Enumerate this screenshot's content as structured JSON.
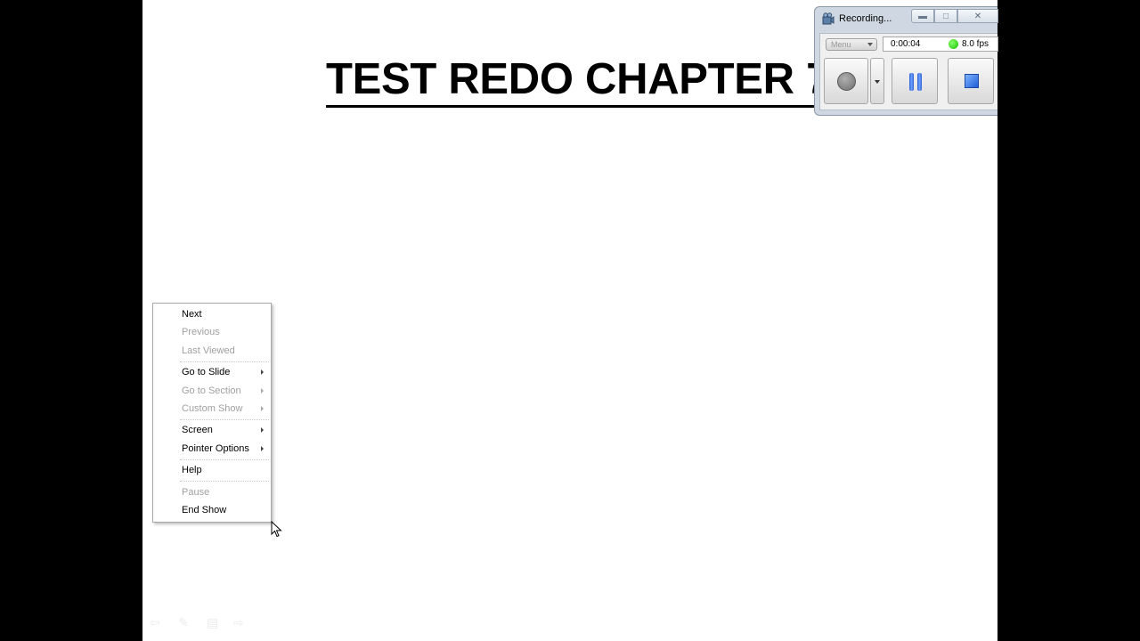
{
  "slide": {
    "title": "TEST REDO CHAPTER 7"
  },
  "context_menu": {
    "items": [
      {
        "label": "Next",
        "disabled": false
      },
      {
        "label": "Previous",
        "disabled": true
      },
      {
        "label": "Last Viewed",
        "disabled": true
      },
      {
        "label": "Go to Slide",
        "disabled": false,
        "submenu": true
      },
      {
        "label": "Go to Section",
        "disabled": true,
        "submenu": true
      },
      {
        "label": "Custom Show",
        "disabled": true,
        "submenu": true
      },
      {
        "label": "Screen",
        "disabled": false,
        "submenu": true
      },
      {
        "label": "Pointer Options",
        "disabled": false,
        "submenu": true
      },
      {
        "label": "Help",
        "disabled": false
      },
      {
        "label": "Pause",
        "disabled": true
      },
      {
        "label": "End Show",
        "disabled": false
      }
    ]
  },
  "recorder": {
    "title": "Recording...",
    "menu_label": "Menu",
    "elapsed": "0:00:04",
    "fps": "8.0 fps",
    "status_color": "#16c000"
  },
  "icons": {
    "titlebar": "recorder-camera-icon",
    "record": "record-circle-icon",
    "pause": "pause-icon",
    "stop": "stop-icon",
    "cursor": "mouse-pointer-icon"
  }
}
